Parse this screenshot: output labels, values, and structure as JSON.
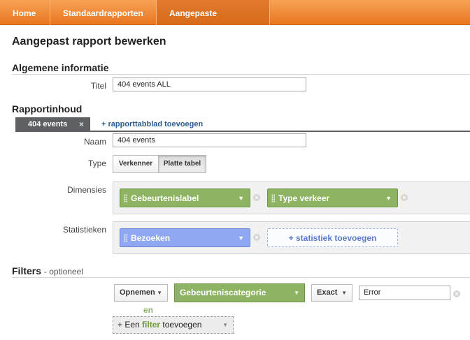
{
  "nav": {
    "tabs": [
      {
        "label": "Home"
      },
      {
        "label": "Standaardrapporten"
      },
      {
        "label": "Aangepaste rapporten"
      }
    ]
  },
  "page": {
    "title": "Aangepast rapport bewerken"
  },
  "general": {
    "title": "Algemene informatie",
    "title_label": "Titel",
    "title_value": "404 events ALL"
  },
  "content": {
    "title": "Rapportinhoud",
    "report_tab": "404 events",
    "close_glyph": "×",
    "add_tab_link": "+ rapporttabblad toevoegen",
    "name_label": "Naam",
    "name_value": "404 events",
    "type_label": "Type",
    "type_options": [
      "Verkenner",
      "Platte tabel"
    ],
    "type_selected": "Platte tabel",
    "dimensions_label": "Dimensies",
    "dimensions": [
      "Gebeurtenislabel",
      "Type verkeer"
    ],
    "metrics_label": "Statistieken",
    "metrics": [
      "Bezoeken"
    ],
    "add_metric": "+ statistiek toevoegen"
  },
  "filters": {
    "title": "Filters",
    "optional": "- optioneel",
    "include_select": "Opnemen",
    "dimension_select": "Gebeurteniscategorie",
    "match_select": "Exact",
    "value": "Error",
    "and_label": "en",
    "add_filter_prefix": "+ Een ",
    "add_filter_highlight": "filter",
    "add_filter_suffix": " toevoegen"
  },
  "colors": {
    "nav": "#e9761f",
    "dimension": "#8db363",
    "metric": "#8fa8f1",
    "report_tab": "#5f6063"
  },
  "icons": {
    "remove": "remove-icon",
    "caret": "chevron-down-icon",
    "grip": "drag-handle-icon"
  }
}
